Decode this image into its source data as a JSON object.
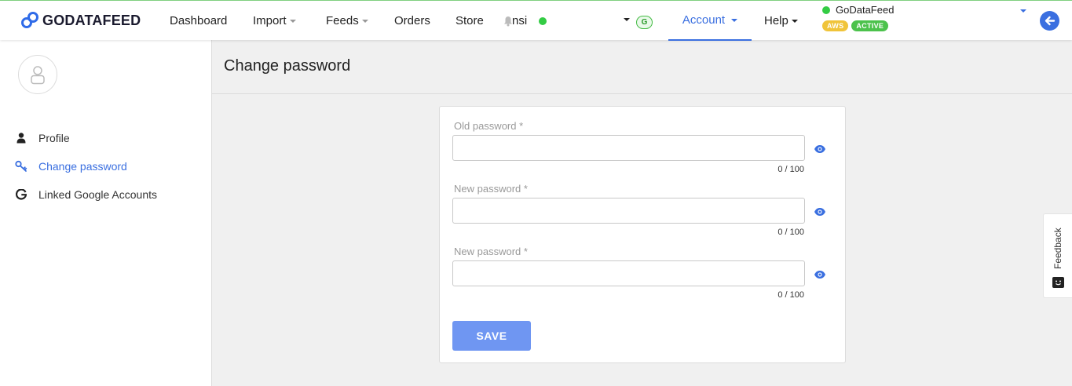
{
  "brand": {
    "logo_text": "GODATAFEED"
  },
  "nav": {
    "items": [
      {
        "label": "Dashboard",
        "has_caret": false
      },
      {
        "label": "Import",
        "has_caret": true
      },
      {
        "label": "Feeds",
        "has_caret": true
      },
      {
        "label": "Orders",
        "has_caret": false
      },
      {
        "label": "Store",
        "has_caret": false
      }
    ],
    "user_fragment": "nsi",
    "status_color": "#33cc44",
    "g_badge": "G",
    "account_label": "Account",
    "help_label": "Help"
  },
  "org": {
    "name": "GoDataFeed",
    "badges": {
      "aws": "AWS",
      "active": "ACTIVE"
    }
  },
  "sidebar": {
    "items": [
      {
        "label": "Profile",
        "icon": "user-icon",
        "active": false
      },
      {
        "label": "Change password",
        "icon": "key-icon",
        "active": true
      },
      {
        "label": "Linked Google Accounts",
        "icon": "google-icon",
        "active": false
      }
    ]
  },
  "page": {
    "title": "Change password"
  },
  "form": {
    "fields": [
      {
        "label": "Old password *",
        "value": "",
        "counter": "0 / 100"
      },
      {
        "label": "New password *",
        "value": "",
        "counter": "0 / 100"
      },
      {
        "label": "New password *",
        "value": "",
        "counter": "0 / 100"
      }
    ],
    "save_label": "SAVE"
  },
  "feedback": {
    "label": "Feedback"
  },
  "colors": {
    "accent": "#3a6fe0",
    "save_button": "#6f96f2",
    "aws": "#f0c43a",
    "active": "#4cc24c"
  }
}
